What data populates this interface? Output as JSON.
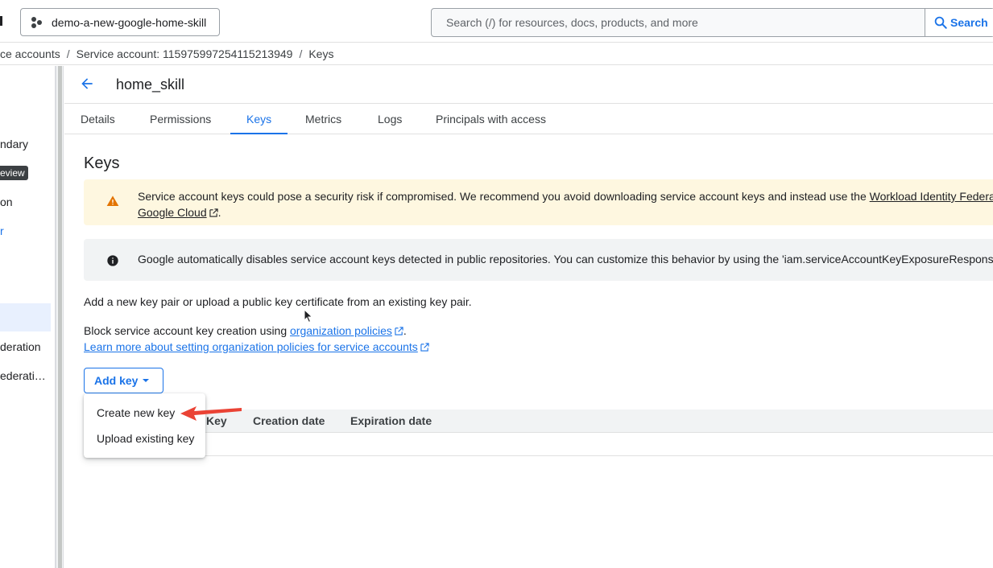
{
  "topbar": {
    "project_name": "demo-a-new-google-home-skill",
    "search_placeholder": "Search (/) for resources, docs, products, and more",
    "search_button": "Search"
  },
  "breadcrumb": {
    "items": [
      "ce accounts",
      "Service account: 115975997254115213949",
      "Keys"
    ],
    "separator": "/"
  },
  "leftnav": {
    "items": [
      "ndary",
      "eview",
      "on",
      "r",
      "deration",
      "ederati…"
    ]
  },
  "page": {
    "title": "home_skill"
  },
  "tabs": [
    "Details",
    "Permissions",
    "Keys",
    "Metrics",
    "Logs",
    "Principals with access"
  ],
  "keys_section": {
    "title": "Keys",
    "warning_text": "Service account keys could pose a security risk if compromised. We recommend you avoid downloading service account keys and instead use the ",
    "warning_link": "Workload Identity Federatio",
    "warning_link2": "Google Cloud",
    "warning_end": ".",
    "info_text": "Google automatically disables service account keys detected in public repositories. You can customize this behavior by using the 'iam.serviceAccountKeyExposureResponse'",
    "add_text": "Add a new key pair or upload a public key certificate from an existing key pair.",
    "block_text": "Block service account key creation using ",
    "block_link": "organization policies",
    "block_end": ".",
    "learn_more": "Learn more about setting organization policies for service accounts",
    "add_key_button": "Add key"
  },
  "table": {
    "headers": [
      "Key",
      "Creation date",
      "Expiration date"
    ]
  },
  "menu": {
    "items": [
      "Create new key",
      "Upload existing key"
    ]
  },
  "colors": {
    "accent": "#1a73e8",
    "warning_bg": "#fef7e0",
    "info_bg": "#f1f3f4",
    "annotation_arrow": "#ea4335"
  }
}
